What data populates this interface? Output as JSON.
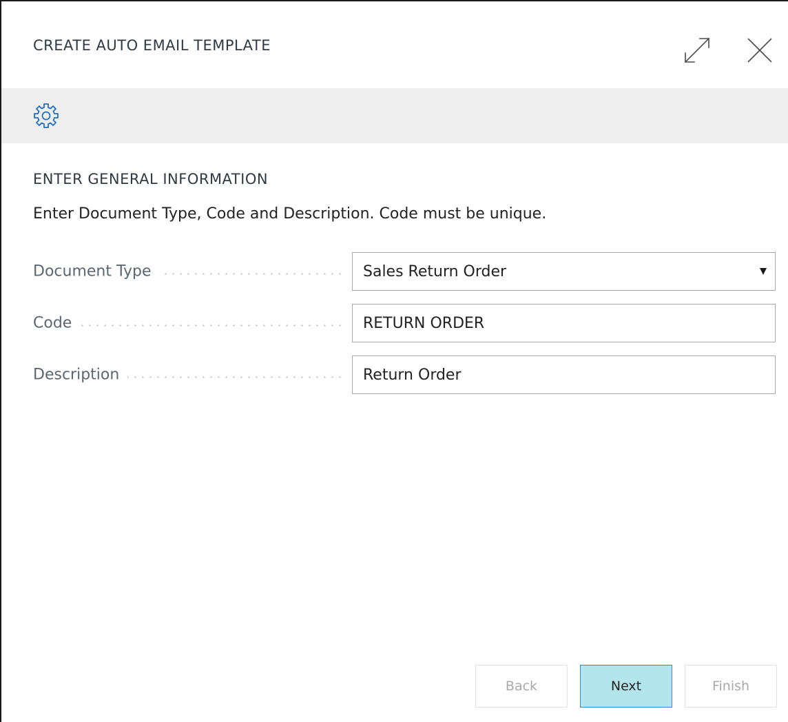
{
  "dialog": {
    "title": "CREATE AUTO EMAIL TEMPLATE"
  },
  "toolbar": {
    "icon": "settings-gear-icon",
    "accent_color": "#1f6fc5"
  },
  "section": {
    "heading": "ENTER GENERAL INFORMATION",
    "instructions": "Enter Document Type, Code and Description. Code must be unique."
  },
  "fields": {
    "document_type": {
      "label": "Document Type",
      "value": "Sales Return Order"
    },
    "code": {
      "label": "Code",
      "value": "RETURN ORDER"
    },
    "description": {
      "label": "Description",
      "value": "Return Order"
    }
  },
  "buttons": {
    "back": "Back",
    "next": "Next",
    "finish": "Finish"
  },
  "colors": {
    "next_button_bg": "#b3e6ec",
    "next_button_border": "#3a84c9",
    "disabled_text": "#a9a9a9"
  }
}
